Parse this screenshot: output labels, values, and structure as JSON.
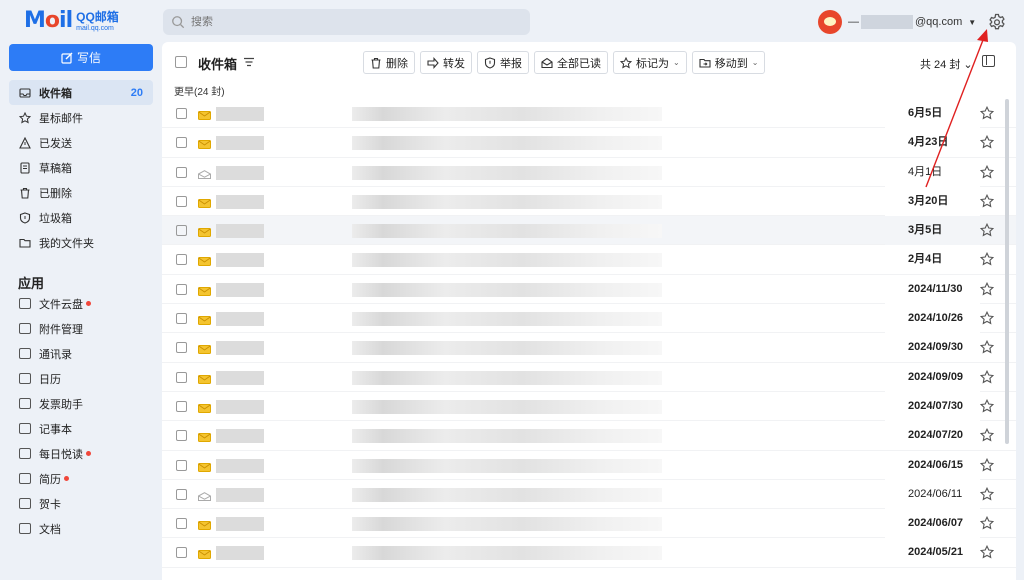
{
  "brand": {
    "logo_main": "Mail",
    "logo_sub": "QQ邮箱",
    "logo_url": "mail.qq.com"
  },
  "search": {
    "placeholder": "搜索"
  },
  "account": {
    "prefix": "—",
    "suffix": "@qq.com"
  },
  "compose": {
    "label": "写信"
  },
  "nav": [
    {
      "label": "收件箱",
      "icon": "inbox-icon",
      "count": "20",
      "active": true
    },
    {
      "label": "星标邮件",
      "icon": "star-icon"
    },
    {
      "label": "已发送",
      "icon": "send-icon"
    },
    {
      "label": "草稿箱",
      "icon": "draft-icon"
    },
    {
      "label": "已删除",
      "icon": "trash-icon"
    },
    {
      "label": "垃圾箱",
      "icon": "shield-icon"
    },
    {
      "label": "我的文件夹",
      "icon": "folder-icon"
    }
  ],
  "apps": {
    "title": "应用",
    "items": [
      {
        "label": "文件云盘",
        "dot": true
      },
      {
        "label": "附件管理"
      },
      {
        "label": "通讯录"
      },
      {
        "label": "日历"
      },
      {
        "label": "发票助手"
      },
      {
        "label": "记事本"
      },
      {
        "label": "每日悦读",
        "dot": true
      },
      {
        "label": "简历",
        "dot": true
      },
      {
        "label": "贺卡"
      },
      {
        "label": "文档"
      }
    ]
  },
  "toolbar": {
    "title": "收件箱",
    "buttons": [
      {
        "label": "删除",
        "icon": "trash-icon"
      },
      {
        "label": "转发",
        "icon": "forward-icon"
      },
      {
        "label": "举报",
        "icon": "report-icon"
      },
      {
        "label": "全部已读",
        "icon": "read-all-icon"
      },
      {
        "label": "标记为",
        "icon": "star-icon",
        "caret": true
      },
      {
        "label": "移动到",
        "icon": "move-icon",
        "caret": true
      }
    ],
    "total": "共 24 封"
  },
  "group_label": "更早(24 封)",
  "emails": [
    {
      "date": "6月5日",
      "unread": true
    },
    {
      "date": "4月23日",
      "unread": true
    },
    {
      "date": "4月1日",
      "unread": false
    },
    {
      "date": "3月20日",
      "unread": true
    },
    {
      "date": "3月5日",
      "unread": true
    },
    {
      "date": "2月4日",
      "unread": true
    },
    {
      "date": "2024/11/30",
      "unread": true
    },
    {
      "date": "2024/10/26",
      "unread": true
    },
    {
      "date": "2024/09/30",
      "unread": true
    },
    {
      "date": "2024/09/09",
      "unread": true
    },
    {
      "date": "2024/07/30",
      "unread": true
    },
    {
      "date": "2024/07/20",
      "unread": true
    },
    {
      "date": "2024/06/15",
      "unread": true
    },
    {
      "date": "2024/06/11",
      "unread": false
    },
    {
      "date": "2024/06/07",
      "unread": true
    },
    {
      "date": "2024/05/21",
      "unread": true
    }
  ],
  "colors": {
    "accent": "#2d7cf6",
    "annotation": "#e02020",
    "unread_envelope": "#f4c430"
  }
}
